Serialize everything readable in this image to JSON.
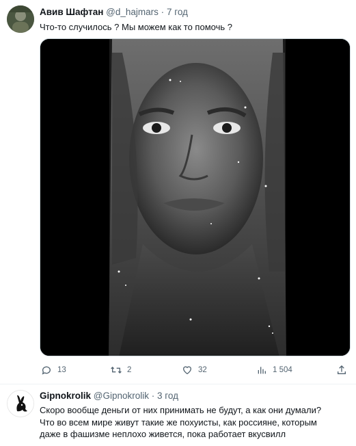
{
  "tweets": [
    {
      "author_name": "Авив Шафтан",
      "handle": "@d_hajmars",
      "dot": "·",
      "time": "7 год",
      "text": "Что-то случилось ? Мы можем как то помочь ?",
      "actions": {
        "replies": "13",
        "retweets": "2",
        "likes": "32",
        "views": "1 504"
      }
    },
    {
      "author_name": "Gipnokrolik",
      "handle": "@Gipnokrolik",
      "dot": "·",
      "time": "3 год",
      "text_lines": [
        "Скоро вообще деньги от них принимать не будут, а как они думали?",
        "Что во всем мире живут такие же похуисты, как россияне, которым",
        "даже в фашизме неплохо живется, пока работает вкусвилл"
      ]
    }
  ],
  "icons": {
    "reply": "reply-icon",
    "retweet": "retweet-icon",
    "like": "heart-icon",
    "views": "views-icon",
    "share": "share-icon"
  },
  "colors": {
    "text_primary": "#0f1419",
    "text_secondary": "#536471",
    "border": "#cfd9de"
  }
}
